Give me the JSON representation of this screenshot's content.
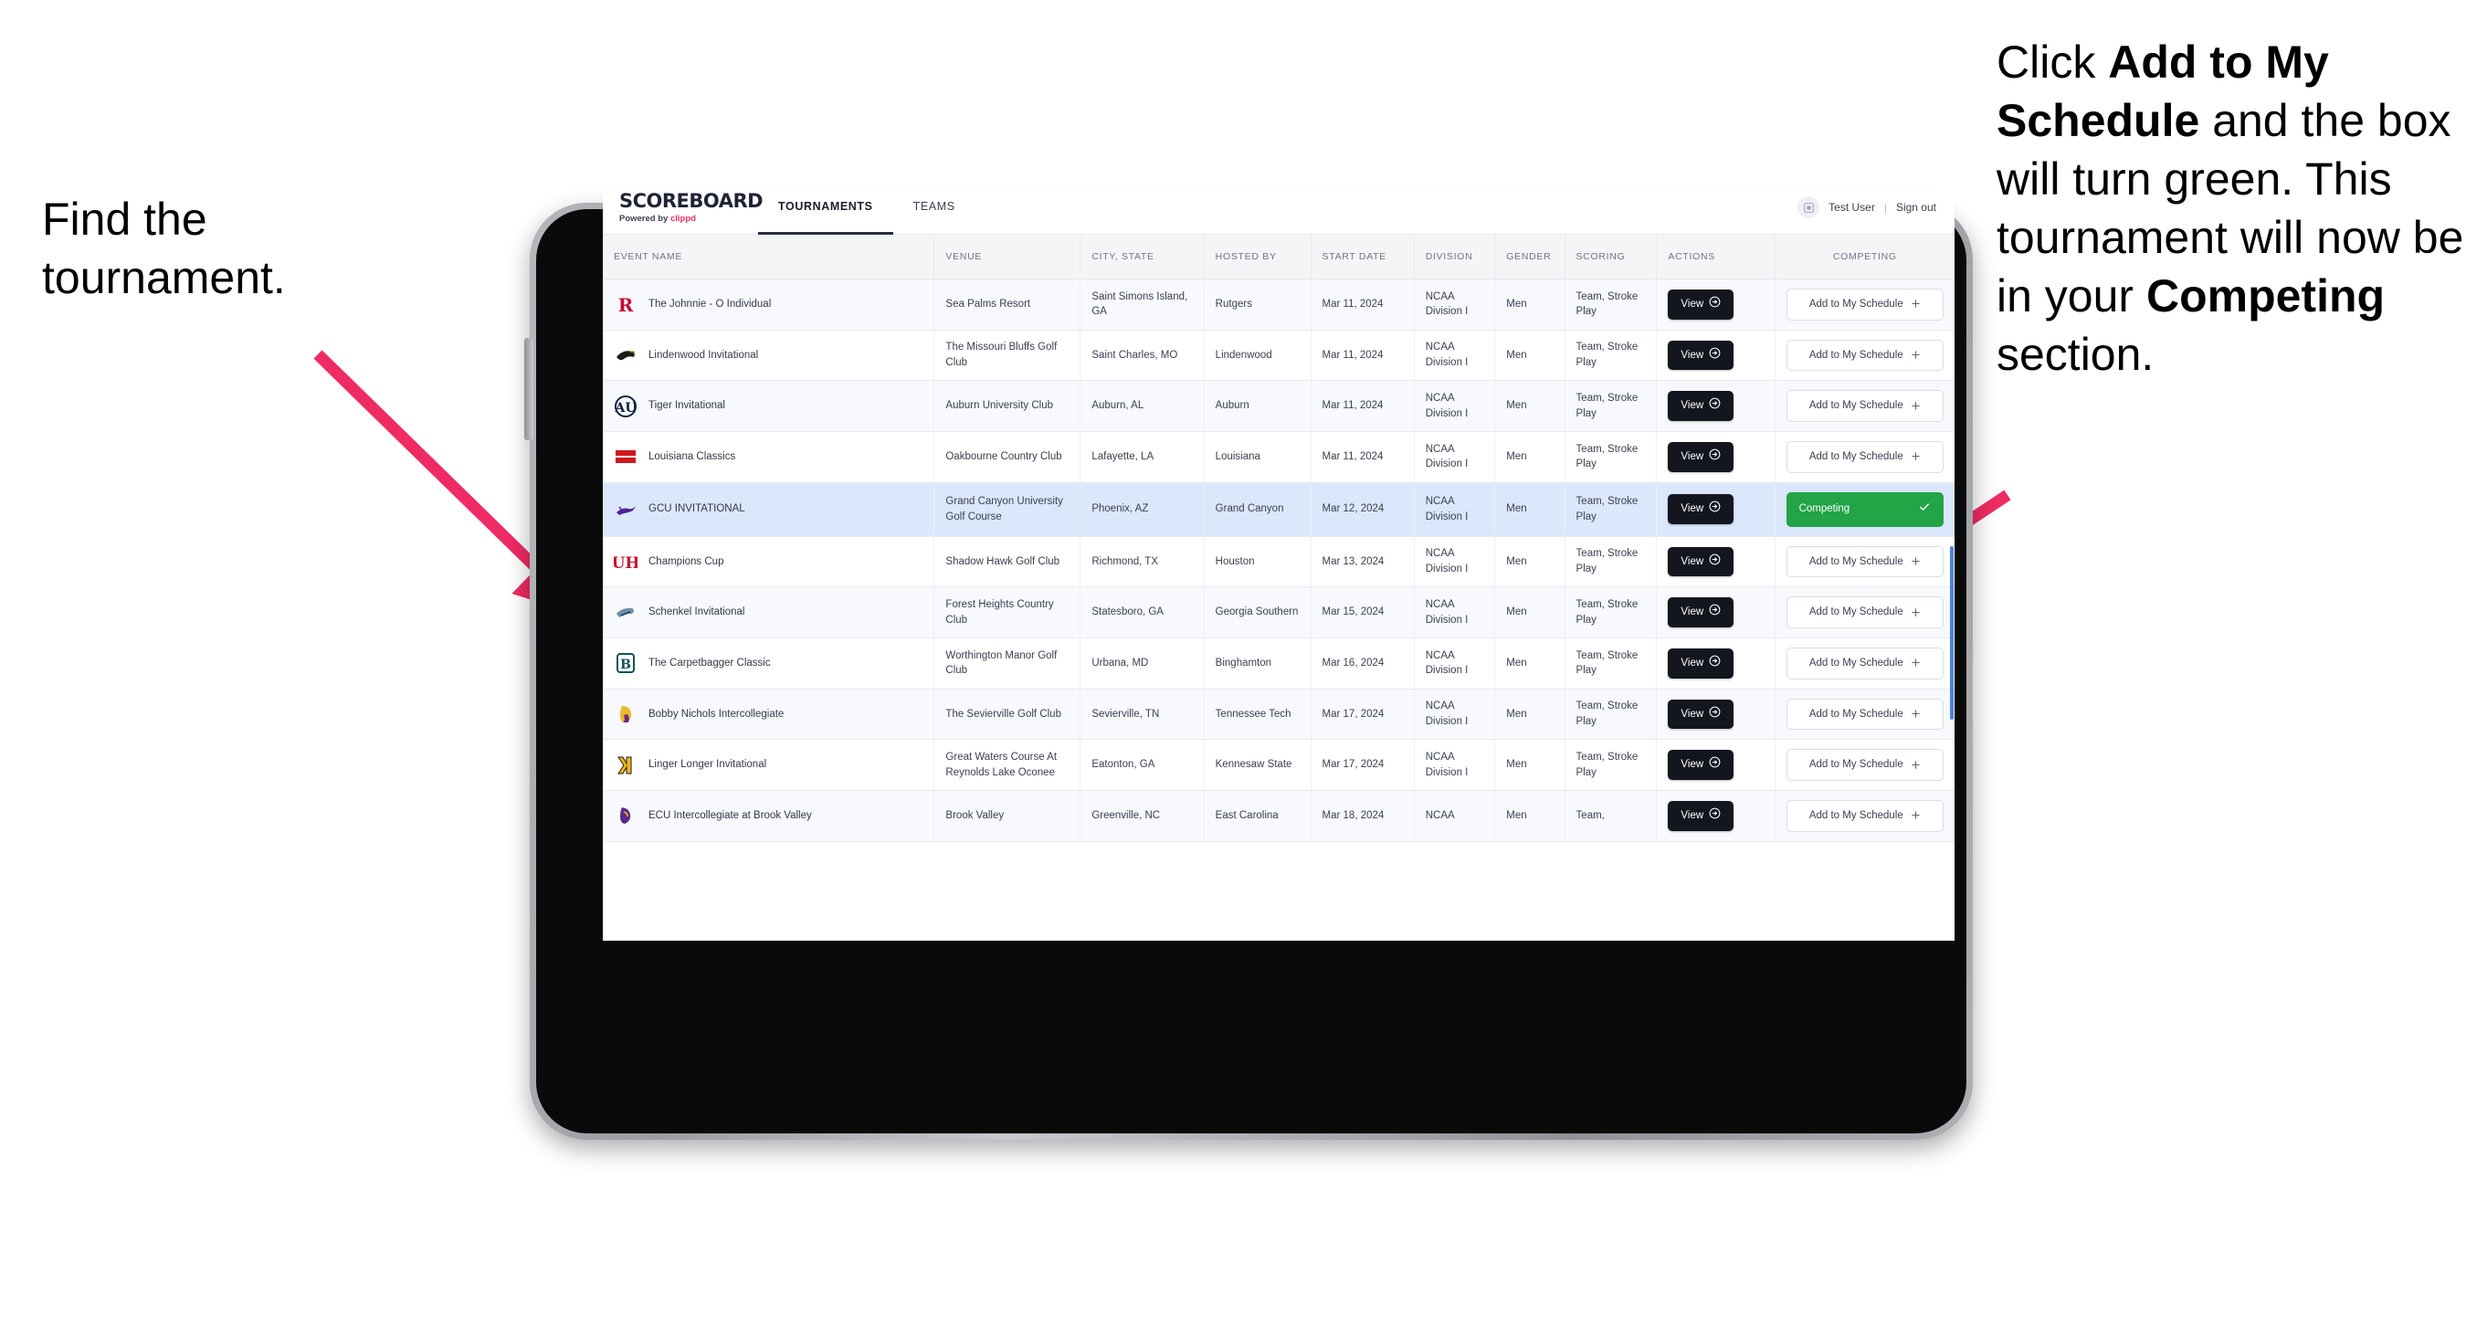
{
  "annotations": {
    "left": "Find the tournament.",
    "right_parts": [
      {
        "t": "Click ",
        "b": false
      },
      {
        "t": "Add to My Schedule",
        "b": true
      },
      {
        "t": " and the box will turn green. This tournament will now be in your ",
        "b": false
      },
      {
        "t": "Competing",
        "b": true
      },
      {
        "t": " section.",
        "b": false
      }
    ]
  },
  "app": {
    "brand": {
      "title": "SCOREBOARD",
      "powered_prefix": "Powered by ",
      "powered_name": "clippd"
    },
    "nav": [
      {
        "label": "TOURNAMENTS",
        "active": true
      },
      {
        "label": "TEAMS",
        "active": false
      }
    ],
    "user": {
      "avatar_icon": "user-avatar-icon",
      "name": "Test User",
      "separator": "|",
      "signout": "Sign out"
    },
    "table": {
      "columns": [
        "EVENT NAME",
        "VENUE",
        "CITY, STATE",
        "HOSTED BY",
        "START DATE",
        "DIVISION",
        "GENDER",
        "SCORING",
        "ACTIONS",
        "COMPETING"
      ],
      "view_label": "View",
      "add_label": "Add to My Schedule",
      "competing_label": "Competing",
      "plus_icon": "plus-icon",
      "check_icon": "check-icon",
      "arrow_icon": "circle-arrow-right-icon",
      "rows": [
        {
          "logo": "rutgers-logo",
          "name": "The Johnnie - O Individual",
          "venue": "Sea Palms Resort",
          "city": "Saint Simons Island, GA",
          "host": "Rutgers",
          "date": "Mar 11, 2024",
          "division": "NCAA Division I",
          "gender": "Men",
          "scoring": "Team, Stroke Play",
          "competing": false
        },
        {
          "logo": "lindenwood-logo",
          "name": "Lindenwood Invitational",
          "venue": "The Missouri Bluffs Golf Club",
          "city": "Saint Charles, MO",
          "host": "Lindenwood",
          "date": "Mar 11, 2024",
          "division": "NCAA Division I",
          "gender": "Men",
          "scoring": "Team, Stroke Play",
          "competing": false
        },
        {
          "logo": "auburn-logo",
          "name": "Tiger Invitational",
          "venue": "Auburn University Club",
          "city": "Auburn, AL",
          "host": "Auburn",
          "date": "Mar 11, 2024",
          "division": "NCAA Division I",
          "gender": "Men",
          "scoring": "Team, Stroke Play",
          "competing": false
        },
        {
          "logo": "louisiana-ragin-cajuns-logo",
          "name": "Louisiana Classics",
          "venue": "Oakbourne Country Club",
          "city": "Lafayette, LA",
          "host": "Louisiana",
          "date": "Mar 11, 2024",
          "division": "NCAA Division I",
          "gender": "Men",
          "scoring": "Team, Stroke Play",
          "competing": false
        },
        {
          "logo": "grand-canyon-lopes-logo",
          "name": "GCU INVITATIONAL",
          "venue": "Grand Canyon University Golf Course",
          "city": "Phoenix, AZ",
          "host": "Grand Canyon",
          "date": "Mar 12, 2024",
          "division": "NCAA Division I",
          "gender": "Men",
          "scoring": "Team, Stroke Play",
          "competing": true
        },
        {
          "logo": "houston-logo",
          "name": "Champions Cup",
          "venue": "Shadow Hawk Golf Club",
          "city": "Richmond, TX",
          "host": "Houston",
          "date": "Mar 13, 2024",
          "division": "NCAA Division I",
          "gender": "Men",
          "scoring": "Team, Stroke Play",
          "competing": false
        },
        {
          "logo": "georgia-southern-logo",
          "name": "Schenkel Invitational",
          "venue": "Forest Heights Country Club",
          "city": "Statesboro, GA",
          "host": "Georgia Southern",
          "date": "Mar 15, 2024",
          "division": "NCAA Division I",
          "gender": "Men",
          "scoring": "Team, Stroke Play",
          "competing": false
        },
        {
          "logo": "binghamton-logo",
          "name": "The Carpetbagger Classic",
          "venue": "Worthington Manor Golf Club",
          "city": "Urbana, MD",
          "host": "Binghamton",
          "date": "Mar 16, 2024",
          "division": "NCAA Division I",
          "gender": "Men",
          "scoring": "Team, Stroke Play",
          "competing": false
        },
        {
          "logo": "tennessee-tech-logo",
          "name": "Bobby Nichols Intercollegiate",
          "venue": "The Sevierville Golf Club",
          "city": "Sevierville, TN",
          "host": "Tennessee Tech",
          "date": "Mar 17, 2024",
          "division": "NCAA Division I",
          "gender": "Men",
          "scoring": "Team, Stroke Play",
          "competing": false
        },
        {
          "logo": "kennesaw-state-logo",
          "name": "Linger Longer Invitational",
          "venue": "Great Waters Course At Reynolds Lake Oconee",
          "city": "Eatonton, GA",
          "host": "Kennesaw State",
          "date": "Mar 17, 2024",
          "division": "NCAA Division I",
          "gender": "Men",
          "scoring": "Team, Stroke Play",
          "competing": false
        },
        {
          "logo": "east-carolina-logo",
          "name": "ECU Intercollegiate at Brook Valley",
          "venue": "Brook Valley",
          "city": "Greenville, NC",
          "host": "East Carolina",
          "date": "Mar 18, 2024",
          "division": "NCAA",
          "gender": "Men",
          "scoring": "Team,",
          "competing": false
        }
      ]
    }
  },
  "colors": {
    "accent_pink": "#ef2b63",
    "competing_green": "#22a447",
    "selected_row_blue": "#dbe7fb",
    "dark_button": "#14161f",
    "scrollbar_blue": "#2f6fd8"
  }
}
